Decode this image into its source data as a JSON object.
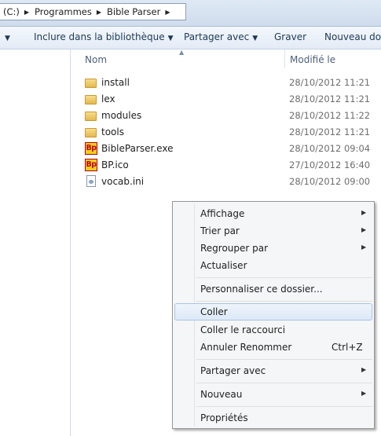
{
  "address": {
    "crumbs": [
      "(C:)",
      "Programmes",
      "Bible Parser"
    ],
    "separator_icon": "breadcrumb-arrow-icon"
  },
  "commands": {
    "include_label": "Inclure dans la bibliothèque",
    "share_label": "Partager avec",
    "burn_label": "Graver",
    "new_folder_label": "Nouveau dossier"
  },
  "columns": {
    "name": "Nom",
    "modified": "Modifié le"
  },
  "files": [
    {
      "name": "install",
      "date": "28/10/2012 11:21",
      "icon": "folder-icon"
    },
    {
      "name": "lex",
      "date": "28/10/2012 11:21",
      "icon": "folder-icon"
    },
    {
      "name": "modules",
      "date": "28/10/2012 11:22",
      "icon": "folder-icon"
    },
    {
      "name": "tools",
      "date": "28/10/2012 11:21",
      "icon": "folder-icon"
    },
    {
      "name": "BibleParser.exe",
      "date": "28/10/2012 09:04",
      "icon": "bp-app-icon"
    },
    {
      "name": "BP.ico",
      "date": "27/10/2012 16:40",
      "icon": "bp-app-icon"
    },
    {
      "name": "vocab.ini",
      "date": "28/10/2012 09:00",
      "icon": "settings-file-icon"
    }
  ],
  "bp_icon_text": "Bp",
  "context_menu": {
    "view": "Affichage",
    "sort_by": "Trier par",
    "group_by": "Regrouper par",
    "refresh": "Actualiser",
    "customize": "Personnaliser ce dossier...",
    "paste": "Coller",
    "paste_shortcut": "Coller le raccourci",
    "undo_rename": "Annuler Renommer",
    "undo_shortcut": "Ctrl+Z",
    "share_with": "Partager avec",
    "new": "Nouveau",
    "properties": "Propriétés"
  },
  "colors": {
    "menu_highlight": "#dde9f7",
    "folder": "#e2b84e",
    "bp_icon_bg": "#f1cd1a",
    "bp_icon_text": "#c4001a"
  }
}
